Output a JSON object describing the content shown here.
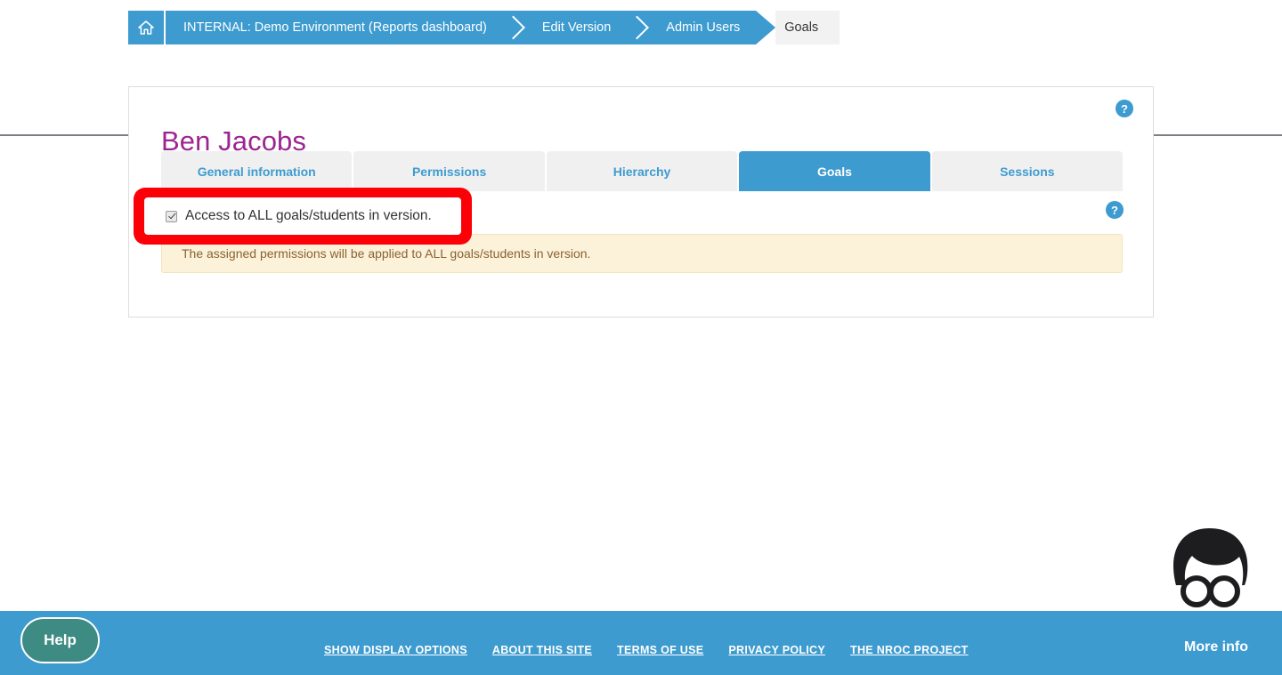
{
  "breadcrumb": {
    "home_icon": "home-icon",
    "items": [
      {
        "label": "INTERNAL: Demo Environment (Reports dashboard)",
        "current": false
      },
      {
        "label": "Edit Version",
        "current": false
      },
      {
        "label": "Admin Users",
        "current": false
      },
      {
        "label": "Goals",
        "current": true
      }
    ]
  },
  "card": {
    "title": "Ben Jacobs",
    "help_icon_label": "?",
    "tabs": [
      {
        "label": "General information",
        "active": false
      },
      {
        "label": "Permissions",
        "active": false
      },
      {
        "label": "Hierarchy",
        "active": false
      },
      {
        "label": "Goals",
        "active": true
      },
      {
        "label": "Sessions",
        "active": false
      }
    ],
    "checkbox": {
      "label": "Access to ALL goals/students in version.",
      "checked": true
    },
    "row_help_icon_label": "?",
    "alert": {
      "text": "The assigned permissions will be applied to ALL goals/students in version."
    }
  },
  "footer": {
    "help_button": "Help",
    "links": [
      "SHOW DISPLAY OPTIONS",
      "ABOUT THIS SITE",
      "TERMS OF USE",
      "PRIVACY POLICY",
      "THE NROC PROJECT"
    ],
    "more_info": "More info"
  },
  "colors": {
    "brand_blue": "#3d9bd0",
    "title_purple": "#9c2591",
    "alert_bg": "#fcf2d9",
    "alert_text": "#8a6234",
    "highlight_red": "#fb0007",
    "help_teal": "#3e8b83"
  }
}
